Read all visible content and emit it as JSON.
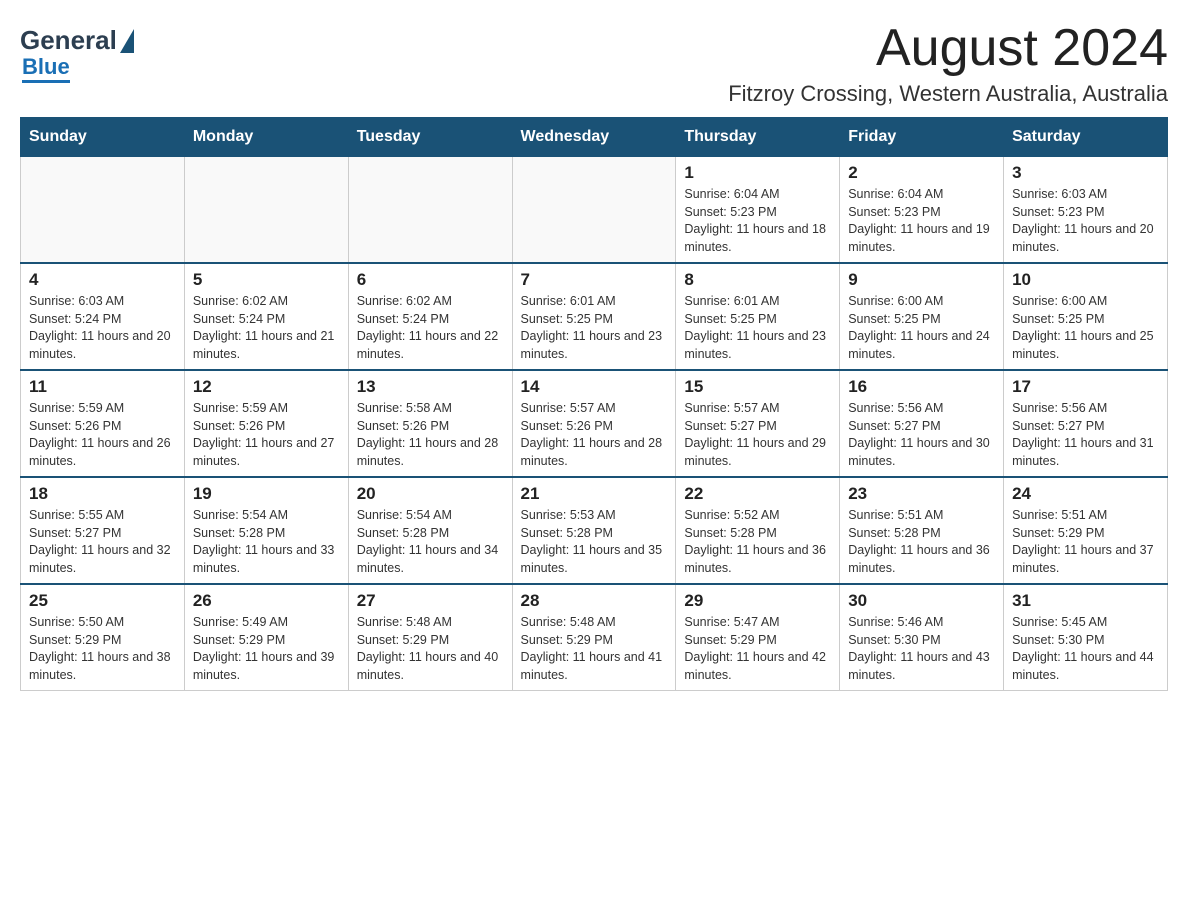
{
  "logo": {
    "general": "General",
    "blue": "Blue",
    "alt": "GeneralBlue logo"
  },
  "header": {
    "month_year": "August 2024",
    "location": "Fitzroy Crossing, Western Australia, Australia"
  },
  "days_of_week": [
    "Sunday",
    "Monday",
    "Tuesday",
    "Wednesday",
    "Thursday",
    "Friday",
    "Saturday"
  ],
  "weeks": [
    [
      {
        "day": "",
        "sunrise": "",
        "sunset": "",
        "daylight": ""
      },
      {
        "day": "",
        "sunrise": "",
        "sunset": "",
        "daylight": ""
      },
      {
        "day": "",
        "sunrise": "",
        "sunset": "",
        "daylight": ""
      },
      {
        "day": "",
        "sunrise": "",
        "sunset": "",
        "daylight": ""
      },
      {
        "day": "1",
        "sunrise": "Sunrise: 6:04 AM",
        "sunset": "Sunset: 5:23 PM",
        "daylight": "Daylight: 11 hours and 18 minutes."
      },
      {
        "day": "2",
        "sunrise": "Sunrise: 6:04 AM",
        "sunset": "Sunset: 5:23 PM",
        "daylight": "Daylight: 11 hours and 19 minutes."
      },
      {
        "day": "3",
        "sunrise": "Sunrise: 6:03 AM",
        "sunset": "Sunset: 5:23 PM",
        "daylight": "Daylight: 11 hours and 20 minutes."
      }
    ],
    [
      {
        "day": "4",
        "sunrise": "Sunrise: 6:03 AM",
        "sunset": "Sunset: 5:24 PM",
        "daylight": "Daylight: 11 hours and 20 minutes."
      },
      {
        "day": "5",
        "sunrise": "Sunrise: 6:02 AM",
        "sunset": "Sunset: 5:24 PM",
        "daylight": "Daylight: 11 hours and 21 minutes."
      },
      {
        "day": "6",
        "sunrise": "Sunrise: 6:02 AM",
        "sunset": "Sunset: 5:24 PM",
        "daylight": "Daylight: 11 hours and 22 minutes."
      },
      {
        "day": "7",
        "sunrise": "Sunrise: 6:01 AM",
        "sunset": "Sunset: 5:25 PM",
        "daylight": "Daylight: 11 hours and 23 minutes."
      },
      {
        "day": "8",
        "sunrise": "Sunrise: 6:01 AM",
        "sunset": "Sunset: 5:25 PM",
        "daylight": "Daylight: 11 hours and 23 minutes."
      },
      {
        "day": "9",
        "sunrise": "Sunrise: 6:00 AM",
        "sunset": "Sunset: 5:25 PM",
        "daylight": "Daylight: 11 hours and 24 minutes."
      },
      {
        "day": "10",
        "sunrise": "Sunrise: 6:00 AM",
        "sunset": "Sunset: 5:25 PM",
        "daylight": "Daylight: 11 hours and 25 minutes."
      }
    ],
    [
      {
        "day": "11",
        "sunrise": "Sunrise: 5:59 AM",
        "sunset": "Sunset: 5:26 PM",
        "daylight": "Daylight: 11 hours and 26 minutes."
      },
      {
        "day": "12",
        "sunrise": "Sunrise: 5:59 AM",
        "sunset": "Sunset: 5:26 PM",
        "daylight": "Daylight: 11 hours and 27 minutes."
      },
      {
        "day": "13",
        "sunrise": "Sunrise: 5:58 AM",
        "sunset": "Sunset: 5:26 PM",
        "daylight": "Daylight: 11 hours and 28 minutes."
      },
      {
        "day": "14",
        "sunrise": "Sunrise: 5:57 AM",
        "sunset": "Sunset: 5:26 PM",
        "daylight": "Daylight: 11 hours and 28 minutes."
      },
      {
        "day": "15",
        "sunrise": "Sunrise: 5:57 AM",
        "sunset": "Sunset: 5:27 PM",
        "daylight": "Daylight: 11 hours and 29 minutes."
      },
      {
        "day": "16",
        "sunrise": "Sunrise: 5:56 AM",
        "sunset": "Sunset: 5:27 PM",
        "daylight": "Daylight: 11 hours and 30 minutes."
      },
      {
        "day": "17",
        "sunrise": "Sunrise: 5:56 AM",
        "sunset": "Sunset: 5:27 PM",
        "daylight": "Daylight: 11 hours and 31 minutes."
      }
    ],
    [
      {
        "day": "18",
        "sunrise": "Sunrise: 5:55 AM",
        "sunset": "Sunset: 5:27 PM",
        "daylight": "Daylight: 11 hours and 32 minutes."
      },
      {
        "day": "19",
        "sunrise": "Sunrise: 5:54 AM",
        "sunset": "Sunset: 5:28 PM",
        "daylight": "Daylight: 11 hours and 33 minutes."
      },
      {
        "day": "20",
        "sunrise": "Sunrise: 5:54 AM",
        "sunset": "Sunset: 5:28 PM",
        "daylight": "Daylight: 11 hours and 34 minutes."
      },
      {
        "day": "21",
        "sunrise": "Sunrise: 5:53 AM",
        "sunset": "Sunset: 5:28 PM",
        "daylight": "Daylight: 11 hours and 35 minutes."
      },
      {
        "day": "22",
        "sunrise": "Sunrise: 5:52 AM",
        "sunset": "Sunset: 5:28 PM",
        "daylight": "Daylight: 11 hours and 36 minutes."
      },
      {
        "day": "23",
        "sunrise": "Sunrise: 5:51 AM",
        "sunset": "Sunset: 5:28 PM",
        "daylight": "Daylight: 11 hours and 36 minutes."
      },
      {
        "day": "24",
        "sunrise": "Sunrise: 5:51 AM",
        "sunset": "Sunset: 5:29 PM",
        "daylight": "Daylight: 11 hours and 37 minutes."
      }
    ],
    [
      {
        "day": "25",
        "sunrise": "Sunrise: 5:50 AM",
        "sunset": "Sunset: 5:29 PM",
        "daylight": "Daylight: 11 hours and 38 minutes."
      },
      {
        "day": "26",
        "sunrise": "Sunrise: 5:49 AM",
        "sunset": "Sunset: 5:29 PM",
        "daylight": "Daylight: 11 hours and 39 minutes."
      },
      {
        "day": "27",
        "sunrise": "Sunrise: 5:48 AM",
        "sunset": "Sunset: 5:29 PM",
        "daylight": "Daylight: 11 hours and 40 minutes."
      },
      {
        "day": "28",
        "sunrise": "Sunrise: 5:48 AM",
        "sunset": "Sunset: 5:29 PM",
        "daylight": "Daylight: 11 hours and 41 minutes."
      },
      {
        "day": "29",
        "sunrise": "Sunrise: 5:47 AM",
        "sunset": "Sunset: 5:29 PM",
        "daylight": "Daylight: 11 hours and 42 minutes."
      },
      {
        "day": "30",
        "sunrise": "Sunrise: 5:46 AM",
        "sunset": "Sunset: 5:30 PM",
        "daylight": "Daylight: 11 hours and 43 minutes."
      },
      {
        "day": "31",
        "sunrise": "Sunrise: 5:45 AM",
        "sunset": "Sunset: 5:30 PM",
        "daylight": "Daylight: 11 hours and 44 minutes."
      }
    ]
  ]
}
